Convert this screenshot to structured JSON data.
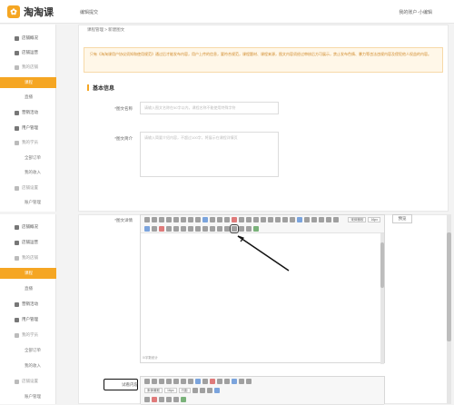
{
  "header": {
    "logo_text": "淘淘课",
    "nav_title": "编辑提交",
    "user": "我的账户·小编辑"
  },
  "sidebar_top": {
    "items": [
      {
        "label": "店铺概况",
        "type": "main"
      },
      {
        "label": "店铺运营",
        "type": "main"
      },
      {
        "label": "我的店铺",
        "type": "main-muted"
      },
      {
        "label": "课程",
        "type": "active"
      },
      {
        "label": "直播",
        "type": "sub"
      },
      {
        "label": "营销活动",
        "type": "main"
      },
      {
        "label": "用户管理",
        "type": "main"
      },
      {
        "label": "我的学员",
        "type": "main-muted"
      },
      {
        "label": "全部订单",
        "type": "sub"
      },
      {
        "label": "我的收入",
        "type": "sub"
      },
      {
        "label": "店铺设置",
        "type": "main-muted"
      },
      {
        "label": "账户管理",
        "type": "sub"
      }
    ]
  },
  "sidebar_bottom": {
    "items": [
      {
        "label": "店铺概况",
        "type": "main"
      },
      {
        "label": "店铺运营",
        "type": "main"
      },
      {
        "label": "我的店铺",
        "type": "main-muted"
      },
      {
        "label": "课程",
        "type": "active"
      },
      {
        "label": "直播",
        "type": "sub"
      },
      {
        "label": "营销活动",
        "type": "main"
      },
      {
        "label": "用户管理",
        "type": "main"
      },
      {
        "label": "我的学员",
        "type": "main-muted"
      },
      {
        "label": "全部订单",
        "type": "sub"
      },
      {
        "label": "我的收入",
        "type": "sub"
      },
      {
        "label": "店铺设置",
        "type": "main-muted"
      },
      {
        "label": "账户管理",
        "type": "sub"
      }
    ]
  },
  "breadcrumb": "课程管理 > 新建图文",
  "notice": "只有《淘淘课用户协议须知和使用规范》通过后才能发布内容，用户上传的信息，要符合规范，课程题材、课程来源，图文内容须经过审核后方可展示，禁止发布色情、暴力等违法违规内容及侵犯他人权益的内容。",
  "section_title": "基本信息",
  "form": {
    "title_label": "*图文名称",
    "title_placeholder": "请输入图文名称在50字以内，课程名称不能使用特殊字符",
    "summary_label": "*图文简介",
    "summary_placeholder": "请输入简要介绍内容，不超过100字，将展示在课程详情页",
    "detail_label": "*图文详情",
    "content_label": "试看内容"
  },
  "editor": {
    "font_family": "宋体微软",
    "font_size": "16px",
    "line_height": "行距",
    "word_count": "0/字数统计",
    "preview_label": "预览"
  },
  "colors": {
    "accent": "#f5a623",
    "sidebar_bg": "#ffffff",
    "notice_bg": "#fff7e8"
  }
}
